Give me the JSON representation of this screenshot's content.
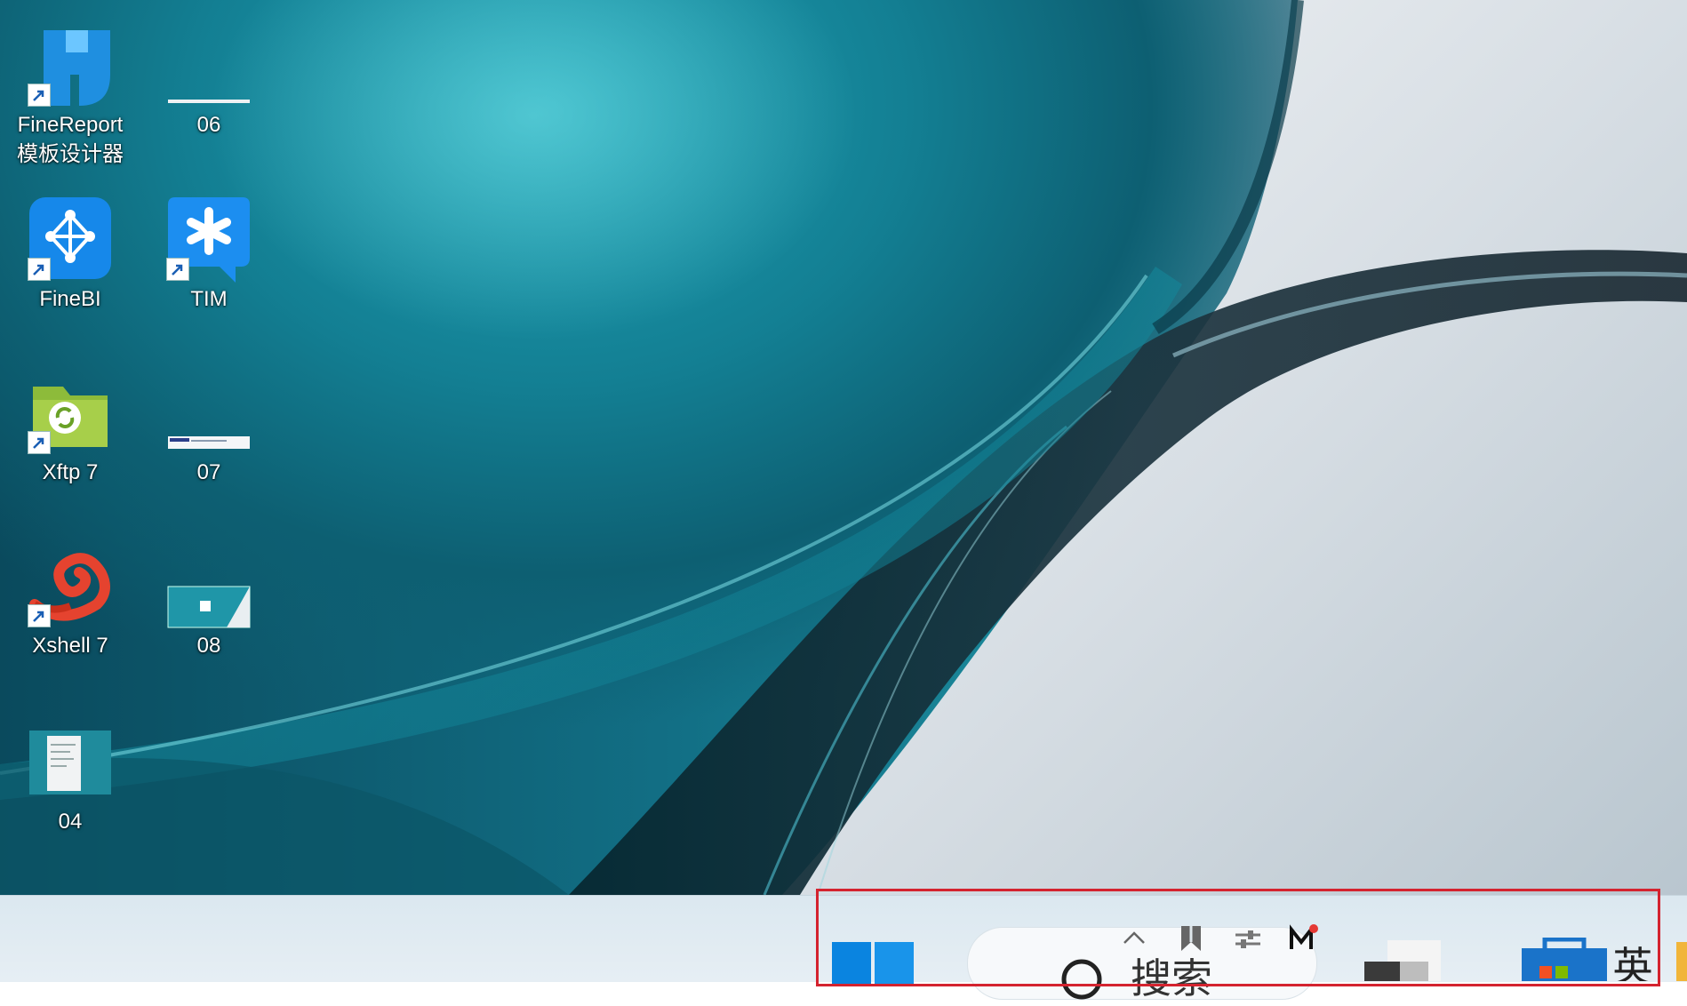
{
  "desktop_icons": [
    {
      "label": "FineReport\n模板设计器",
      "icon": "finereport-icon"
    },
    {
      "label": "06",
      "icon": "image-thumbnail-icon"
    },
    {
      "label": "FineBI",
      "icon": "finebi-icon"
    },
    {
      "label": "TIM",
      "icon": "tim-icon"
    },
    {
      "label": "Xftp 7",
      "icon": "xftp-icon"
    },
    {
      "label": "07",
      "icon": "image-thumbnail-icon"
    },
    {
      "label": "Xshell 7",
      "icon": "xshell-icon"
    },
    {
      "label": "08",
      "icon": "image-thumbnail-icon"
    },
    {
      "label": "04",
      "icon": "image-thumbnail-icon"
    }
  ],
  "taskbar": {
    "search_label": "搜索",
    "icons": [
      "start-icon",
      "chevron-up-icon",
      "bookmark-icon",
      "sliders-icon",
      "mail-icon",
      "app-icon",
      "store-icon"
    ]
  },
  "colors": {
    "highlight": "#d4232f",
    "windows_blue": "#0a84e0"
  }
}
